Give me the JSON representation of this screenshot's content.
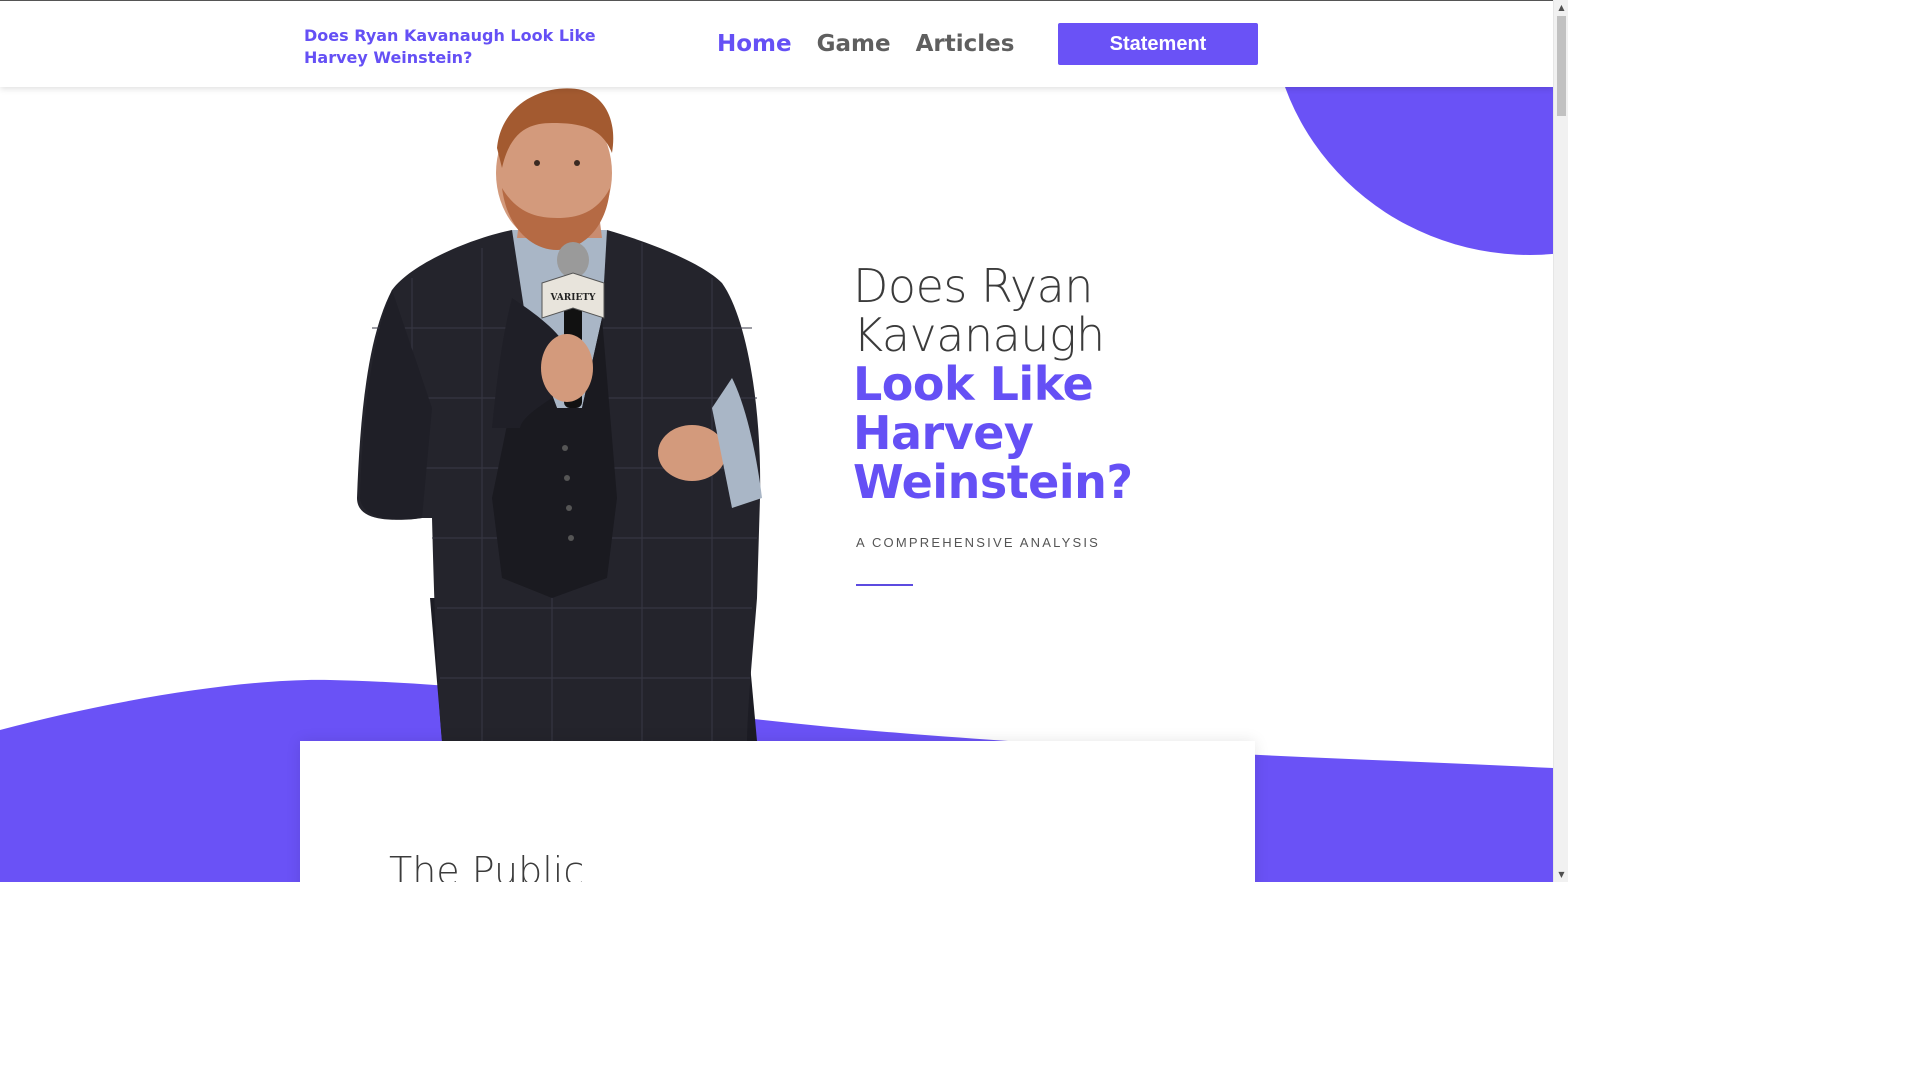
{
  "header": {
    "site_title": "Does Ryan Kavanaugh Look Like Harvey Weinstein?",
    "nav": [
      {
        "label": "Home",
        "active": true
      },
      {
        "label": "Game",
        "active": false
      },
      {
        "label": "Articles",
        "active": false
      }
    ],
    "cta_label": "Statement"
  },
  "hero": {
    "title_light": "Does Ryan Kavanaugh",
    "title_bold": "Look Like Harvey Weinstein?",
    "subtitle": "A COMPREHENSIVE ANALYSIS",
    "mic_label": "VARIETY"
  },
  "card": {
    "heading": "The Public"
  },
  "colors": {
    "accent": "#6a52f6",
    "accent_text": "#6550f5",
    "nav_text": "#5f5f5f",
    "heading_text": "#3b3b3b"
  },
  "icons": {
    "scroll_up": "up-arrow-icon",
    "scroll_down": "down-arrow-icon"
  }
}
